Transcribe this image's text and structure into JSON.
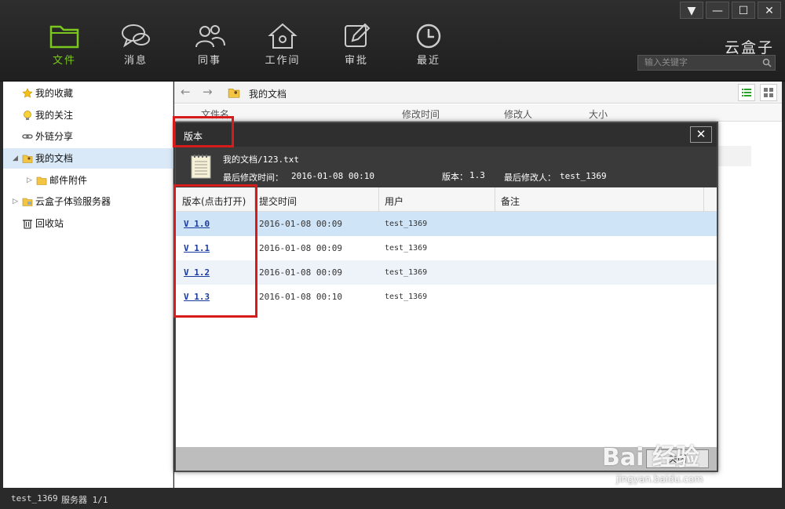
{
  "window": {
    "minimize": "▼",
    "min": "—",
    "max": "☐",
    "close": "✕"
  },
  "brand": "云盒子",
  "search": {
    "placeholder": "输入关键字"
  },
  "nav": [
    {
      "label": "文件",
      "icon": "folder-icon",
      "active": true
    },
    {
      "label": "消息",
      "icon": "chat-icon",
      "active": false
    },
    {
      "label": "同事",
      "icon": "colleagues-icon",
      "active": false
    },
    {
      "label": "工作间",
      "icon": "workspace-icon",
      "active": false
    },
    {
      "label": "审批",
      "icon": "approve-icon",
      "active": false
    },
    {
      "label": "最近",
      "icon": "clock-icon",
      "active": false
    }
  ],
  "sidebar": {
    "items": [
      {
        "label": "我的收藏",
        "icon": "star-icon"
      },
      {
        "label": "我的关注",
        "icon": "bulb-icon"
      },
      {
        "label": "外链分享",
        "icon": "link-icon"
      },
      {
        "label": "我的文档",
        "icon": "user-folder-icon"
      },
      {
        "label": "邮件附件",
        "icon": "folder-icon"
      },
      {
        "label": "云盒子体验服务器",
        "icon": "server-icon"
      },
      {
        "label": "回收站",
        "icon": "trash-icon"
      }
    ]
  },
  "toolbar": {
    "back": "←",
    "forward": "→",
    "path": "我的文档"
  },
  "file_columns": {
    "name": "文件名",
    "modified": "修改时间",
    "modifier": "修改人",
    "size": "大小"
  },
  "dialog": {
    "title": "版本",
    "close": "✕",
    "file_path": "我的文档/123.txt",
    "last_modified_label": "最后修改时间：",
    "last_modified": "2016-01-08 00:10",
    "version_label": "版本：",
    "version": "1.3",
    "last_modifier_label": "最后修改人：",
    "last_modifier": "test_1369",
    "columns": {
      "version": "版本(点击打开)",
      "time": "提交时间",
      "user": "用户",
      "note": "备注"
    },
    "rows": [
      {
        "version": "V 1.0",
        "time": "2016-01-08 00:09",
        "user": "test_1369",
        "note": ""
      },
      {
        "version": "V 1.1",
        "time": "2016-01-08 00:09",
        "user": "test_1369",
        "note": ""
      },
      {
        "version": "V 1.2",
        "time": "2016-01-08 00:09",
        "user": "test_1369",
        "note": ""
      },
      {
        "version": "V 1.3",
        "time": "2016-01-08 00:10",
        "user": "test_1369",
        "note": ""
      }
    ],
    "close_button": "关闭"
  },
  "statusbar": {
    "user": "test_1369",
    "server": "服务器 1/1"
  },
  "watermark": {
    "logo": "Bai 经验",
    "url": "jingyan.baidu.com"
  },
  "colors": {
    "accent": "#7ac81e",
    "highlight_box": "#d71b1b",
    "selected_row": "#cfe4f7"
  }
}
